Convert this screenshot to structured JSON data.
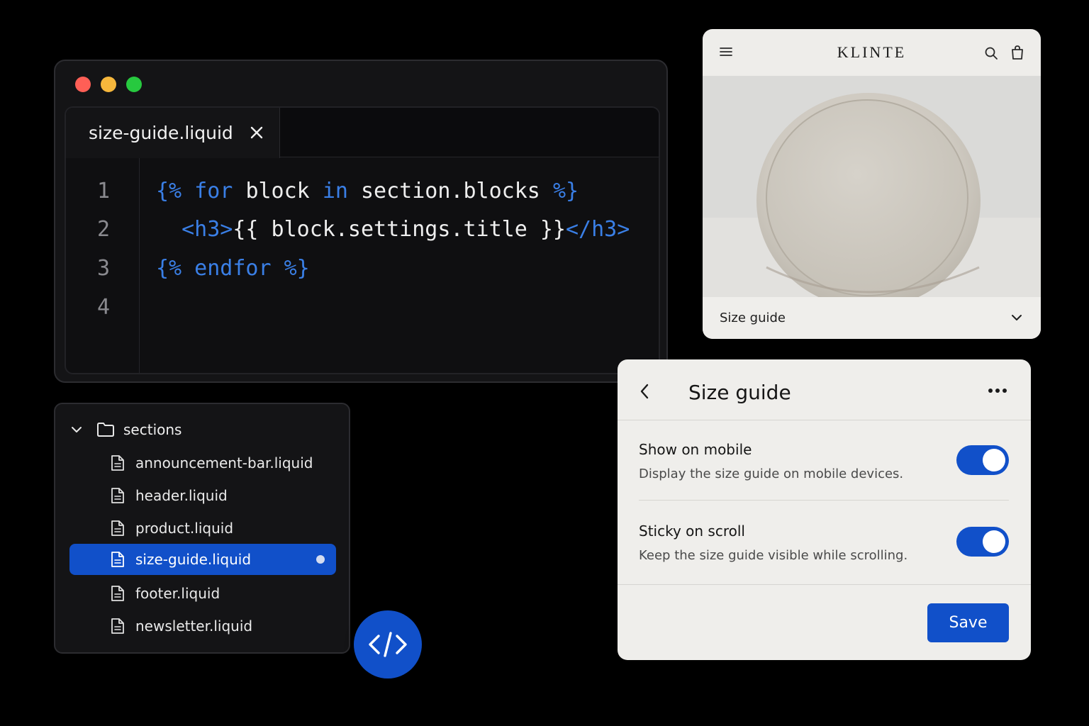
{
  "editor": {
    "tab_label": "size-guide.liquid",
    "lines": [
      {
        "number": "1",
        "tokens": [
          [
            "kw",
            "{% for "
          ],
          [
            "tx",
            "block "
          ],
          [
            "kw",
            "in "
          ],
          [
            "tx",
            "section.blocks "
          ],
          [
            "kw",
            "%}"
          ]
        ]
      },
      {
        "number": "2",
        "tokens": [
          [
            "kw",
            "  <h3>"
          ],
          [
            "tx",
            "{{ block.settings.title }}"
          ],
          [
            "kw",
            "</h3>"
          ]
        ]
      },
      {
        "number": "3",
        "tokens": [
          [
            "kw",
            "{% endfor %}"
          ]
        ]
      },
      {
        "number": "4",
        "tokens": []
      }
    ]
  },
  "file_tree": {
    "folder": "sections",
    "files": [
      {
        "name": "announcement-bar.liquid",
        "selected": false
      },
      {
        "name": "header.liquid",
        "selected": false
      },
      {
        "name": "product.liquid",
        "selected": false
      },
      {
        "name": "size-guide.liquid",
        "selected": true,
        "modified": true
      },
      {
        "name": "footer.liquid",
        "selected": false
      },
      {
        "name": "newsletter.liquid",
        "selected": false
      }
    ]
  },
  "storefront": {
    "brand": "KLINTE",
    "accordion_label": "Size guide"
  },
  "settings": {
    "title": "Size guide",
    "options": [
      {
        "label": "Show on mobile",
        "description": "Display the size guide on mobile devices.",
        "enabled": true
      },
      {
        "label": "Sticky on scroll",
        "description": "Keep the size guide visible while scrolling.",
        "enabled": true
      }
    ],
    "save_label": "Save"
  },
  "colors": {
    "accent": "#1150c9",
    "keyword": "#3a7fe6",
    "background": "#000000"
  }
}
